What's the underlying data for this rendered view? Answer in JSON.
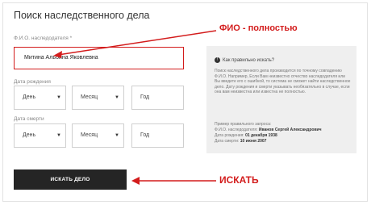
{
  "form": {
    "title": "Поиск наследственного дела",
    "fio_label": "Ф.И.О. наследодателя *",
    "fio_value": "Митина Альбина Яковлевна",
    "birth_label": "Дата рождения",
    "death_label": "Дата смерти",
    "day": "День",
    "month": "Месяц",
    "year": "Год",
    "submit": "ИСКАТЬ ДЕЛО"
  },
  "info": {
    "heading": "Как правильно искать?",
    "body": "Поиск наследственного дела производится по точному совпадению Ф.И.О. Например, Если Вам неизвестно отчество наследодателя или Вы введете его с ошибкой, то система не сможет найти наследственное дело. Дату рождения и смерти указывать необязательно в случае, если она вам неизвестна или известна не полностью.",
    "example_title": "Пример правильного запроса:",
    "ex_fio_label": "Ф.И.О. наследодателя:",
    "ex_fio_value": "Иванов Сергей Александрович",
    "ex_birth_label": "Дата рождения:",
    "ex_birth_value": "01 декабря 1938",
    "ex_death_label": "Дата смерти:",
    "ex_death_value": "10 июня 2007"
  },
  "annotations": {
    "fio_note": "ФИО - полностью",
    "search_note": "ИСКАТЬ",
    "color": "#d31c1c"
  }
}
